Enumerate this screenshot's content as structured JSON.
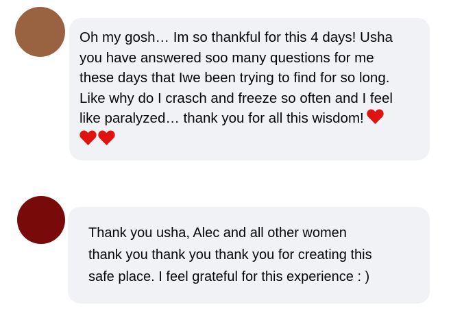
{
  "thread": {
    "comments": [
      {
        "avatar_color": "#996241",
        "lines": [
          "Oh my gosh… Im so thankful for this 4 days! Usha",
          "you have answered soo many questions for me",
          "these days that Iwe been trying to find for so long.",
          "Like why do I crasch and freeze so often and I feel",
          "like paralyzed…  thank you for all this wisdom!"
        ],
        "emojis": [
          "heart-icon",
          "heart-icon",
          "heart-icon"
        ]
      },
      {
        "avatar_color": "#780a0a",
        "lines": [
          "Thank you usha, Alec and all other women",
          "thank you thank you thank you for creating this",
          "safe place. I feel grateful for this experience : )"
        ]
      }
    ]
  },
  "colors": {
    "bubble_bg": "#f0f2f5",
    "text": "#050505",
    "heart": "#e0140f"
  }
}
